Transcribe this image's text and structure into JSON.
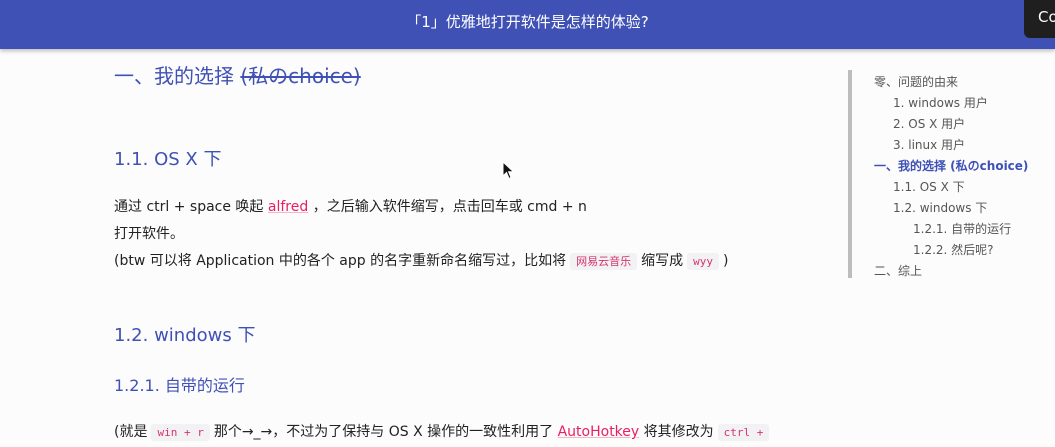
{
  "header": {
    "title": "「1」优雅地打开软件是怎样的体验?",
    "corner_label": "Co"
  },
  "article": {
    "h1_main": "一、我的选择",
    "h1_strike": "(私のchoice)",
    "s1_title": "1.1. OS X 下",
    "p1_a": "通过 ctrl + space 唤起 ",
    "p1_link": "alfred",
    "p1_b": " ，之后输入软件缩写，点击回车或 cmd + n",
    "p2": "打开软件。",
    "p3_a": "(btw 可以将 Application 中的各个 app 的名字重新命名缩写过，比如将",
    "p3_code1": "网易云音乐",
    "p3_b": "缩写成",
    "p3_code2": "wyy",
    "p3_c": ")",
    "s2_title": "1.2. windows 下",
    "s21_title": "1.2.1. 自带的运行",
    "p4_a": "(就是",
    "p4_code1": "win + r",
    "p4_b": "那个→_→，不过为了保持与 OS X 操作的一致性利用了 ",
    "p4_link": "AutoHotkey",
    "p4_c": " 将其修改为",
    "p4_code2": "ctrl +"
  },
  "toc": [
    {
      "label": "零、问题的由来"
    },
    {
      "label": "1. windows 用户"
    },
    {
      "label": "2. OS X 用户"
    },
    {
      "label": "3. linux 用户"
    },
    {
      "label": "一、我的选择 (私のchoice)"
    },
    {
      "label": "1.1. OS X 下"
    },
    {
      "label": "1.2. windows 下"
    },
    {
      "label": "1.2.1. 自带的运行"
    },
    {
      "label": "1.2.2. 然后呢?"
    },
    {
      "label": "二、综上"
    }
  ],
  "colors": {
    "header_bg": "#3f51b5",
    "heading": "#3f51b5",
    "link": "#e91e63",
    "code": "#d6336c"
  }
}
